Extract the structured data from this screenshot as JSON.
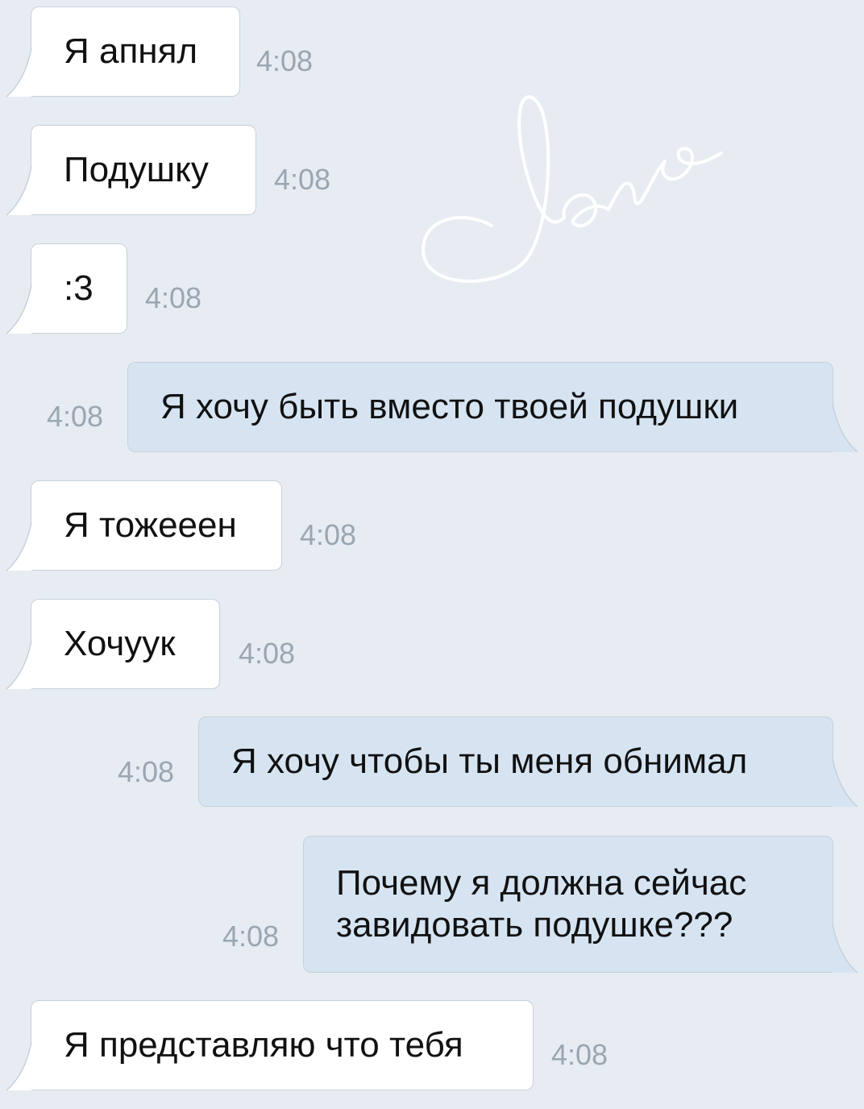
{
  "decoration": {
    "text": "love",
    "color": "#ffffff"
  },
  "colors": {
    "background": "#e7ecf2",
    "incoming_bubble": "#ffffff",
    "outgoing_bubble": "#d6e4f2",
    "timestamp": "#9aa6b2"
  },
  "messages": [
    {
      "direction": "incoming",
      "text": "Я апнял",
      "time": "4:08"
    },
    {
      "direction": "incoming",
      "text": "Подушку",
      "time": "4:08"
    },
    {
      "direction": "incoming",
      "text": ":3",
      "time": "4:08"
    },
    {
      "direction": "outgoing",
      "text": "Я хочу быть вместо твоей подушки",
      "time": "4:08"
    },
    {
      "direction": "incoming",
      "text": "Я тожееен",
      "time": "4:08"
    },
    {
      "direction": "incoming",
      "text": "Хочуук",
      "time": "4:08"
    },
    {
      "direction": "outgoing",
      "text": "Я хочу чтобы ты меня обнимал",
      "time": "4:08"
    },
    {
      "direction": "outgoing",
      "text": "Почему я должна сейчас завидовать подушке???",
      "time": "4:08"
    },
    {
      "direction": "incoming",
      "text": "Я представляю что тебя",
      "time": "4:08"
    }
  ]
}
